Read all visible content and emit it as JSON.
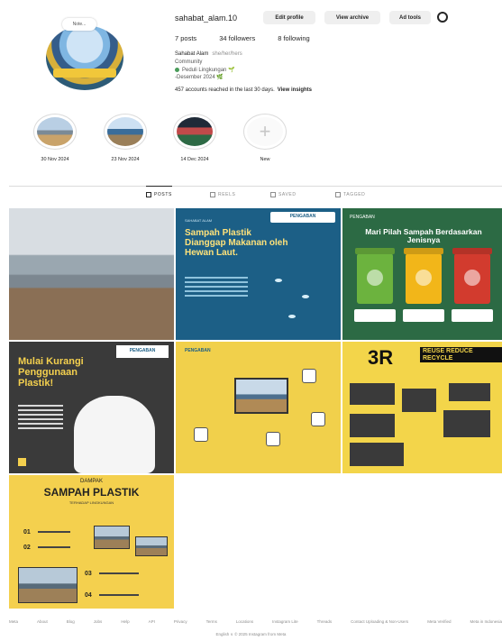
{
  "profile": {
    "username": "sahabat_alam.10",
    "note": "Note...",
    "buttons": {
      "edit": "Edit profile",
      "archive": "View archive",
      "ad_tools": "Ad tools"
    },
    "stats": {
      "posts": "7 posts",
      "followers": "34 followers",
      "following": "8 following"
    },
    "full_name": "Sahabat Alam",
    "pronoun": "she/her/hers",
    "bio": [
      "Community",
      "Peduli Lingkungan 🌱",
      "-Desember 2024 🌿"
    ],
    "reach": "457 accounts reached in the last 30 days.",
    "insights_link": "View insights"
  },
  "highlights": [
    {
      "caption": "30 Nov 2024"
    },
    {
      "caption": "23 Nov 2024"
    },
    {
      "caption": "14 Dec 2024"
    },
    {
      "caption": "New"
    }
  ],
  "tabs": [
    {
      "label": "POSTS",
      "active": true
    },
    {
      "label": "REELS",
      "active": false
    },
    {
      "label": "SAVED",
      "active": false
    },
    {
      "label": "TAGGED",
      "active": false
    }
  ],
  "posts": {
    "p2": {
      "tag": "SAHABAT ALAM",
      "title": "Sampah Plastik Dianggap Makanan oleh Hewan Laut.",
      "logo": "PENGABAN"
    },
    "p3": {
      "logo": "PENGABAN",
      "title": "Mari Pilah Sampah Berdasarkan Jenisnya"
    },
    "p4": {
      "logo": "PENGABAN",
      "title": "Mulai Kurangi Penggunaan Plastik!"
    },
    "p5": {
      "logo": "PENGABAN"
    },
    "p6": {
      "big": "3R",
      "words": "REUSE REDUCE RECYCLE"
    },
    "p7": {
      "pre": "DAMPAK",
      "title": "SAMPAH PLASTIK",
      "sub": "TERHADAP LINGKUNGAN",
      "nums": [
        "01",
        "02",
        "03",
        "04"
      ]
    }
  },
  "footer": {
    "links": [
      "Meta",
      "About",
      "Blog",
      "Jobs",
      "Help",
      "API",
      "Privacy",
      "Terms",
      "Locations",
      "Instagram Lite",
      "Threads",
      "Contact Uploading & Non-Users",
      "Meta Verified",
      "Meta in Indonesia"
    ],
    "copyright": "English ∨   © 2025 Instagram from Meta"
  }
}
